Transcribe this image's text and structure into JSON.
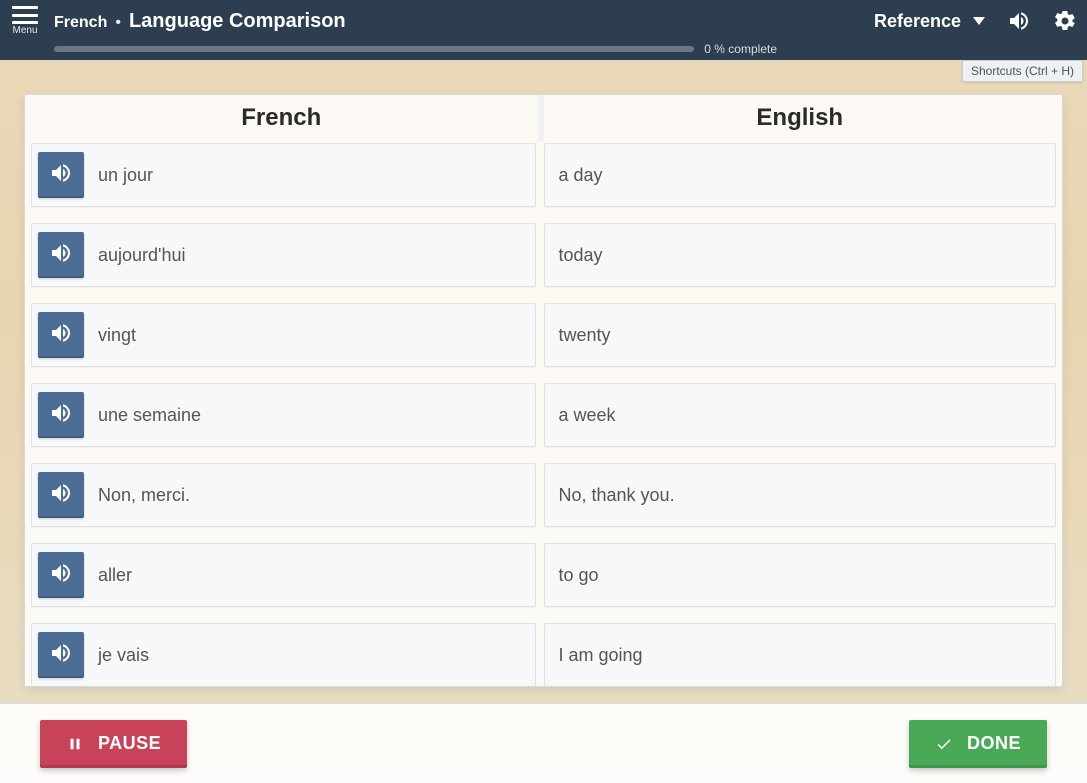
{
  "topbar": {
    "menu_label": "Menu",
    "language": "French",
    "separator": "•",
    "page_title": "Language Comparison",
    "reference_label": "Reference",
    "progress_text": "0 % complete"
  },
  "shortcuts_chip": "Shortcuts  (Ctrl + H)",
  "headers": {
    "left": "French",
    "right": "English"
  },
  "entries": [
    {
      "french": "un jour",
      "english": "a day"
    },
    {
      "french": "aujourd'hui",
      "english": "today"
    },
    {
      "french": "vingt",
      "english": "twenty"
    },
    {
      "french": "une semaine",
      "english": "a week"
    },
    {
      "french": "Non, merci.",
      "english": "No, thank you."
    },
    {
      "french": "aller",
      "english": "to go"
    },
    {
      "french": "je vais",
      "english": "I am going"
    }
  ],
  "footer": {
    "pause_label": "PAUSE",
    "done_label": "DONE"
  }
}
